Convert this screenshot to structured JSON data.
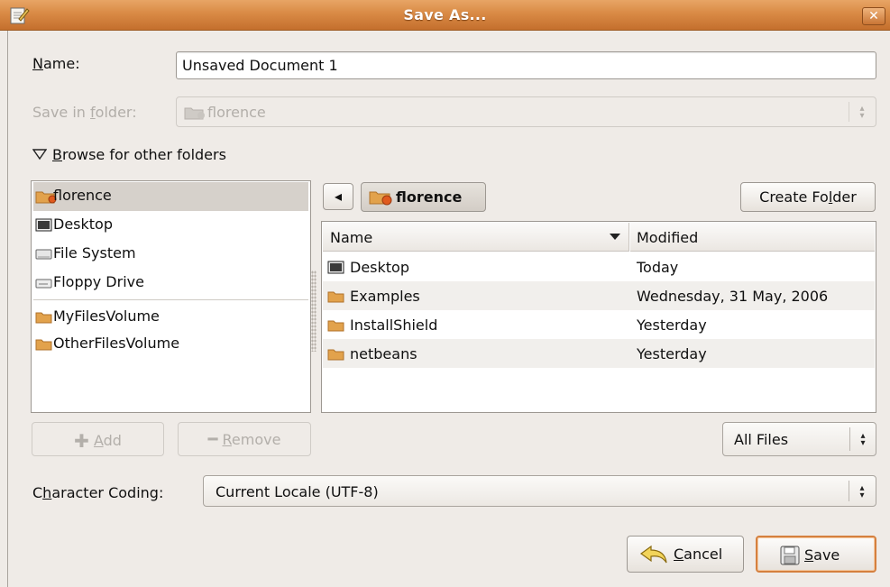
{
  "window": {
    "title": "Save As...",
    "close_glyph": "✕",
    "app_icon": "text-editor-icon"
  },
  "name_row": {
    "label_u": "N",
    "label_rest": "ame:",
    "value": "Unsaved Document 1"
  },
  "save_in": {
    "label_pre": "Save in ",
    "label_u": "f",
    "label_post": "older:",
    "value": "florence"
  },
  "browse": {
    "expander": "expanded",
    "label_u": "B",
    "label_rest": "rowse for other folders"
  },
  "places": {
    "items": [
      {
        "label": "florence",
        "icon": "home-folder-icon",
        "selected": true
      },
      {
        "label": "Desktop",
        "icon": "desktop-icon"
      },
      {
        "label": "File System",
        "icon": "harddisk-icon"
      },
      {
        "label": "Floppy Drive",
        "icon": "floppy-drive-icon"
      }
    ],
    "volumes": [
      {
        "label": "MyFilesVolume",
        "icon": "folder-icon"
      },
      {
        "label": "OtherFilesVolume",
        "icon": "folder-icon"
      }
    ],
    "add": {
      "label_u": "A",
      "label_rest": "dd",
      "enabled": false
    },
    "remove": {
      "label_u": "R",
      "label_rest": "emove",
      "enabled": false
    }
  },
  "path_bar": {
    "current": "florence",
    "back_glyph": "◂"
  },
  "create_folder": {
    "label_pre": "Create Fo",
    "label_u": "l",
    "label_post": "der"
  },
  "files": {
    "columns": {
      "name": "Name",
      "modified": "Modified",
      "sort": "descending"
    },
    "rows": [
      {
        "name": "Desktop",
        "modified": "Today",
        "icon": "desktop-icon"
      },
      {
        "name": "Examples",
        "modified": "Wednesday, 31 May, 2006",
        "icon": "folder-icon"
      },
      {
        "name": "InstallShield",
        "modified": "Yesterday",
        "icon": "folder-icon"
      },
      {
        "name": "netbeans",
        "modified": "Yesterday",
        "icon": "folder-icon"
      }
    ]
  },
  "filter": {
    "value": "All Files"
  },
  "encoding": {
    "label_pre": "C",
    "label_u": "h",
    "label_post": "aracter Coding:",
    "value": "Current Locale (UTF-8)"
  },
  "actions": {
    "cancel": {
      "label_u": "C",
      "label_rest": "ancel"
    },
    "save": {
      "label_u": "S",
      "label_rest": "ave"
    }
  },
  "colors": {
    "titlebar": "#d98a45",
    "accent": "#d5803f",
    "folder": "#e2a24c",
    "selection": "#d6d1cb"
  }
}
